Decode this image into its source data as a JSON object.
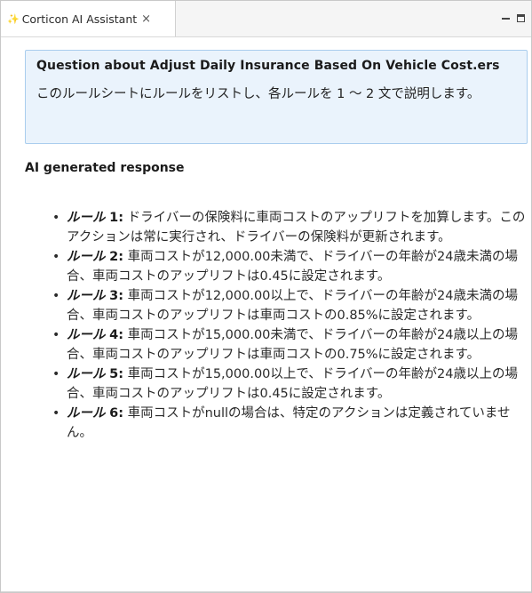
{
  "tab": {
    "icon": "sparkle-icon",
    "title": "Corticon AI Assistant",
    "close": "×"
  },
  "window_controls": {
    "minimize": "minimize-icon",
    "maximize": "maximize-icon"
  },
  "question": {
    "title": "Question about Adjust Daily Insurance Based On Vehicle Cost.ers",
    "text": "このルールシートにルールをリストし、各ルールを 1 ～ 2 文で説明します。"
  },
  "response": {
    "heading": "AI generated response",
    "rules": [
      {
        "label": "ルール",
        "number": "1:",
        "text": "ドライバーの保険料に車両コストのアップリフトを加算します。このアクションは常に実行され、ドライバーの保険料が更新されます。"
      },
      {
        "label": "ルール",
        "number": "2:",
        "text": "車両コストが12,000.00未満で、ドライバーの年齢が24歳未満の場合、車両コストのアップリフトは0.45に設定されます。"
      },
      {
        "label": "ルール",
        "number": "3:",
        "text": "車両コストが12,000.00以上で、ドライバーの年齢が24歳未満の場合、車両コストのアップリフトは車両コストの0.85%に設定されます。"
      },
      {
        "label": "ルール",
        "number": "4:",
        "text": "車両コストが15,000.00未満で、ドライバーの年齢が24歳以上の場合、車両コストのアップリフトは車両コストの0.75%に設定されます。"
      },
      {
        "label": "ルール",
        "number": "5:",
        "text": "車両コストが15,000.00以上で、ドライバーの年齢が24歳以上の場合、車両コストのアップリフトは0.45に設定されます。"
      },
      {
        "label": "ルール",
        "number": "6:",
        "text": "車両コストがnullの場合は、特定のアクションは定義されていません。"
      }
    ]
  }
}
